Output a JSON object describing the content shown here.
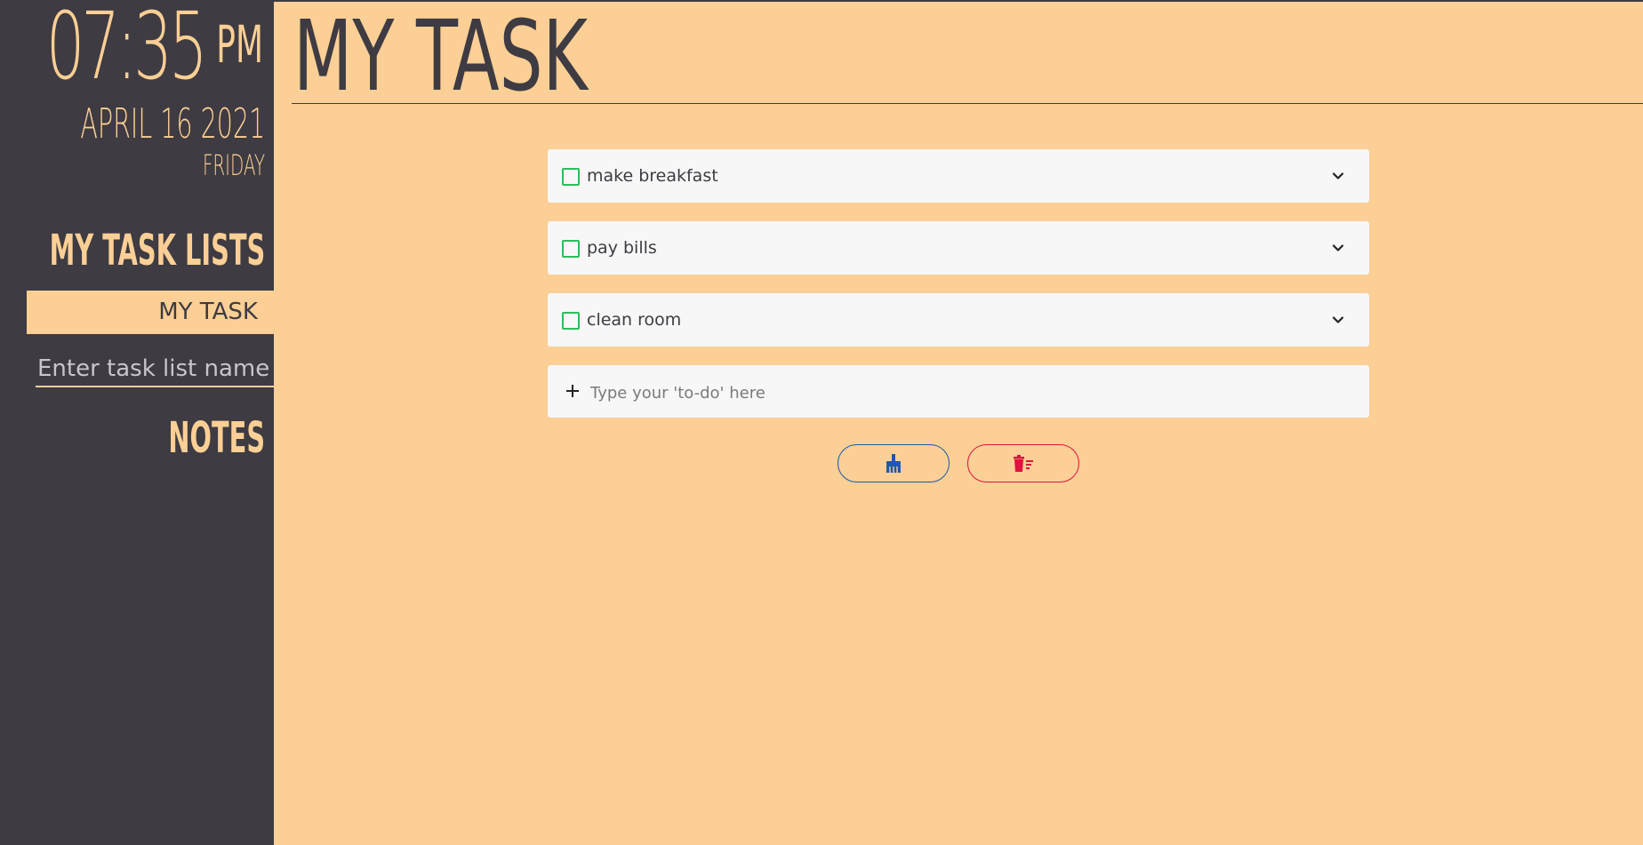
{
  "clock": {
    "time": "07:35",
    "ampm": "PM",
    "date": "APRIL 16 2021",
    "day": "FRIDAY"
  },
  "sidebar": {
    "lists_heading": "MY TASK LISTS",
    "lists": [
      {
        "label": "MY TASK",
        "active": true
      }
    ],
    "new_list_placeholder": "Enter task list name",
    "notes_heading": "NOTES"
  },
  "main": {
    "title": "MY TASK",
    "todos": [
      {
        "label": "make breakfast",
        "done": false
      },
      {
        "label": "pay bills",
        "done": false
      },
      {
        "label": "clean room",
        "done": false
      }
    ],
    "add_placeholder": "Type your 'to-do' here"
  },
  "colors": {
    "background": "#fbcf95",
    "sidebar": "#3e3b42",
    "checkbox": "#2ebd59",
    "clean_button": "#1f5aa8",
    "delete_button": "#e0123f"
  },
  "icons": {
    "clean_button": "broom-icon",
    "delete_button": "trash-list-icon",
    "expand": "chevron-down-icon",
    "add": "plus-icon"
  }
}
